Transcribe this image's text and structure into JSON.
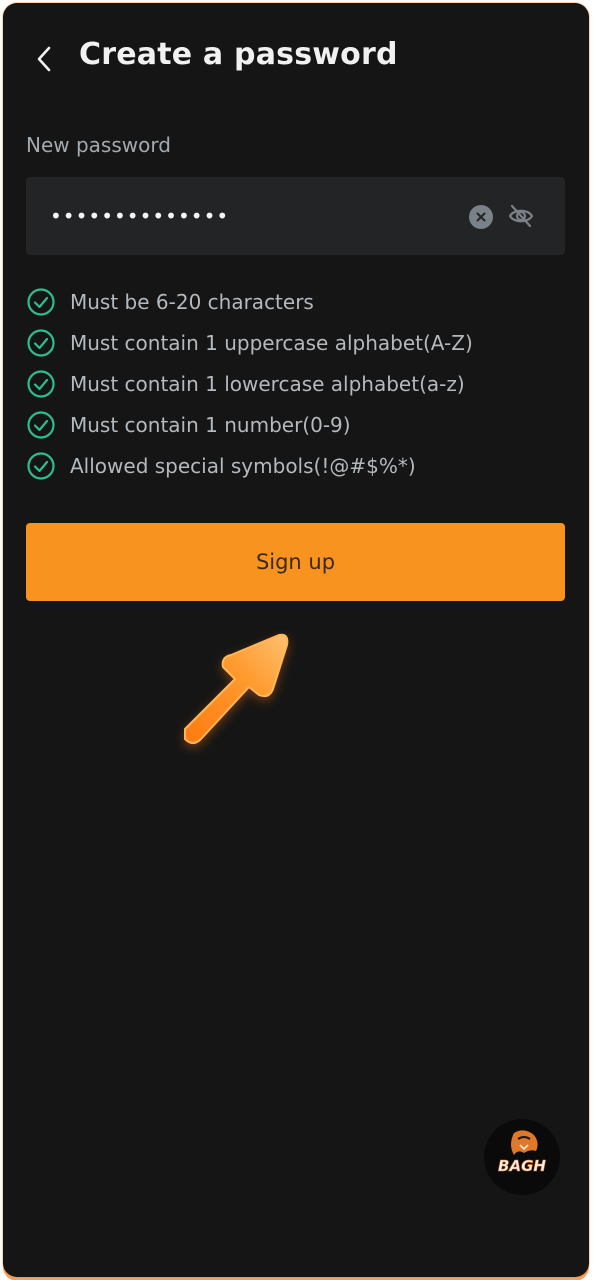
{
  "header": {
    "title": "Create a password"
  },
  "password_field": {
    "label": "New password",
    "value": "••••••••••••••"
  },
  "requirements": [
    {
      "text": "Must be 6-20 characters",
      "met": true
    },
    {
      "text": "Must contain 1 uppercase alphabet(A-Z)",
      "met": true
    },
    {
      "text": "Must contain 1 lowercase alphabet(a-z)",
      "met": true
    },
    {
      "text": "Must contain 1 number(0-9)",
      "met": true
    },
    {
      "text": "Allowed special symbols(!@#$%*)",
      "met": true
    }
  ],
  "signup_button": {
    "label": "Sign up"
  },
  "icons": {
    "back": "chevron-left-icon",
    "clear": "clear-circle-icon",
    "visibility": "eye-off-icon",
    "requirement": "check-circle-icon"
  },
  "colors": {
    "background": "#151515",
    "accent": "#f7931e",
    "check": "#2ebd8f",
    "input_bg": "#222425"
  },
  "logo": {
    "text": "BAGH"
  }
}
